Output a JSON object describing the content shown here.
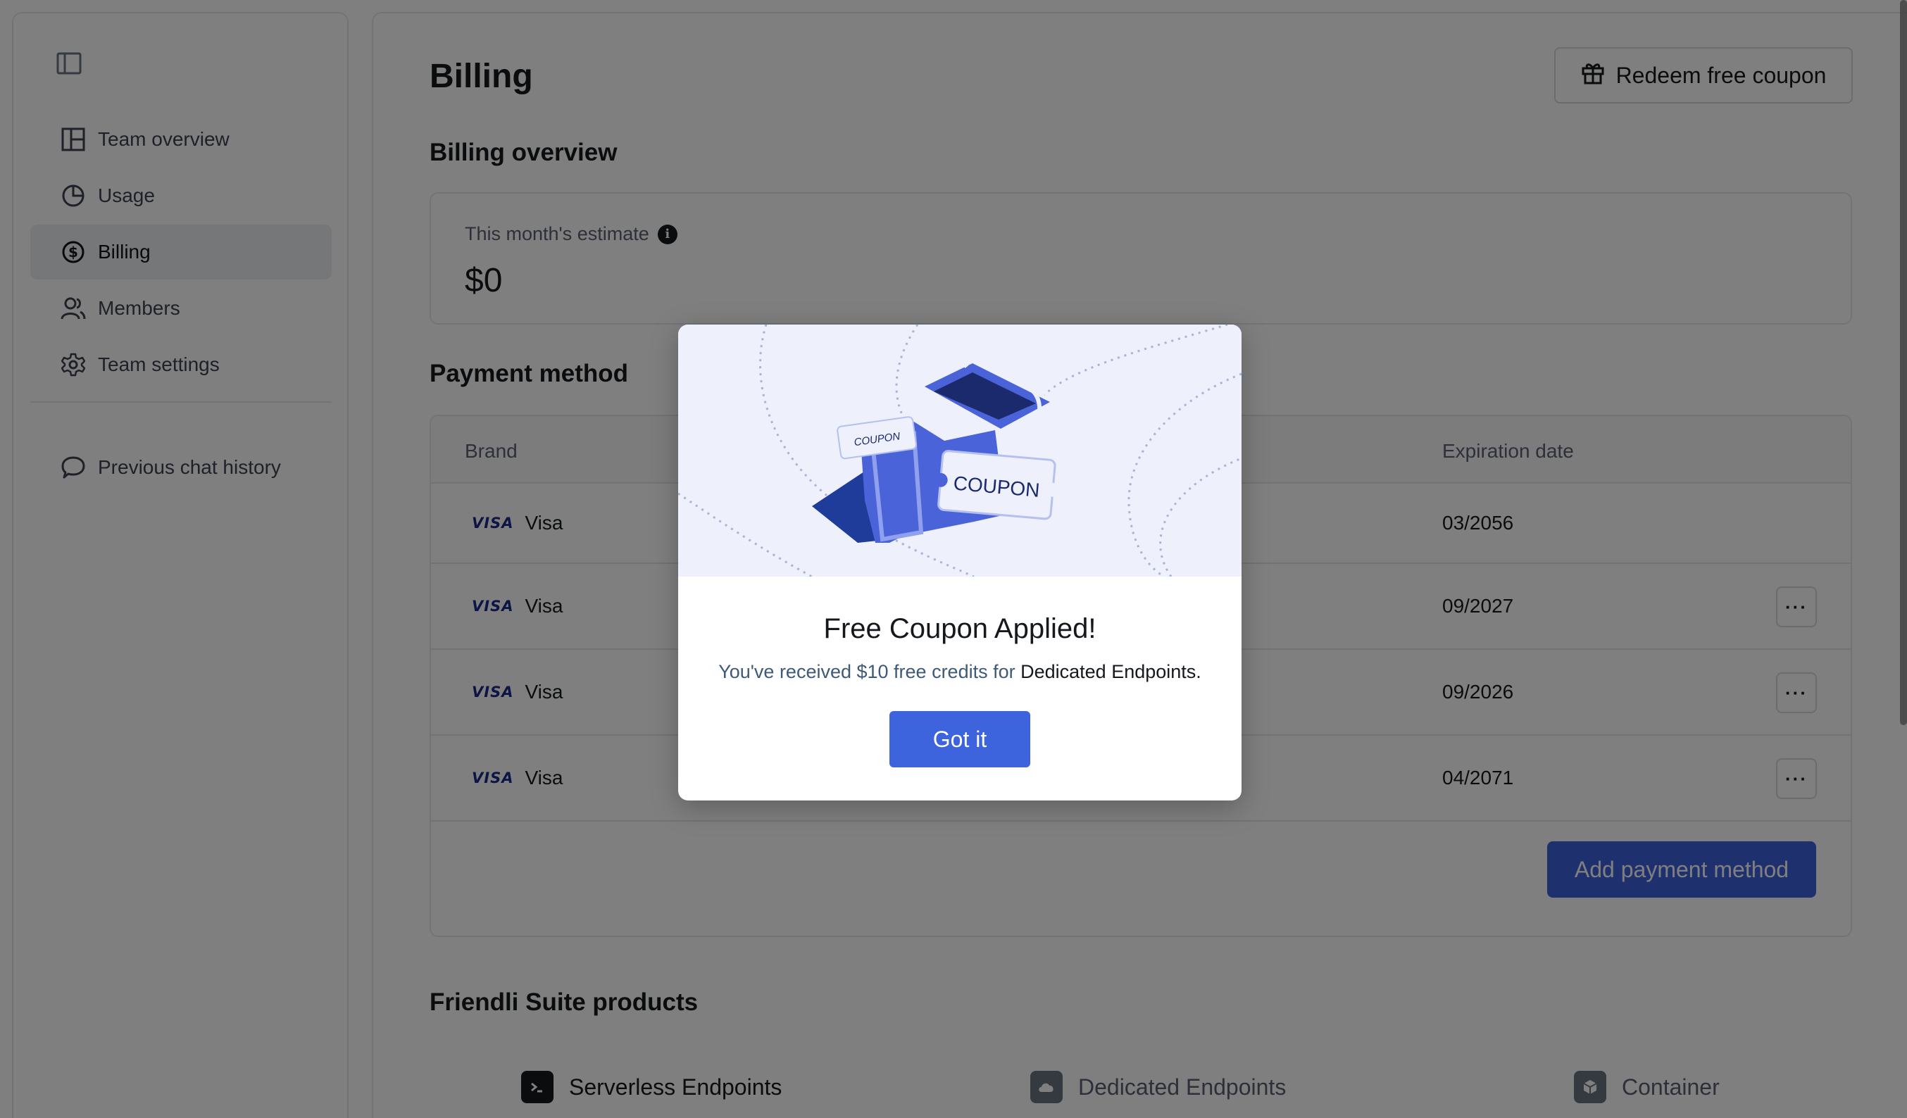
{
  "sidebar": {
    "items": [
      {
        "label": "Team overview",
        "icon": "dashboard-icon"
      },
      {
        "label": "Usage",
        "icon": "pie-chart-icon"
      },
      {
        "label": "Billing",
        "icon": "dollar-circle-icon",
        "active": true
      },
      {
        "label": "Members",
        "icon": "users-icon"
      },
      {
        "label": "Team settings",
        "icon": "gear-icon"
      }
    ],
    "history_label": "Previous chat history"
  },
  "header": {
    "title": "Billing",
    "redeem_label": "Redeem free coupon"
  },
  "overview": {
    "title": "Billing overview",
    "estimate_label": "This month's estimate",
    "estimate_value": "$0"
  },
  "payment": {
    "title": "Payment method",
    "columns": [
      "Brand",
      "Expiration date"
    ],
    "rows": [
      {
        "brand_logo": "VISA",
        "brand": "Visa",
        "expiration": "03/2056"
      },
      {
        "brand_logo": "VISA",
        "brand": "Visa",
        "expiration": "09/2027"
      },
      {
        "brand_logo": "VISA",
        "brand": "Visa",
        "expiration": "09/2026"
      },
      {
        "brand_logo": "VISA",
        "brand": "Visa",
        "expiration": "04/2071"
      }
    ],
    "add_label": "Add payment method"
  },
  "products": {
    "title": "Friendli Suite products",
    "tabs": [
      {
        "label": "Serverless Endpoints",
        "icon": "terminal-icon",
        "active": true
      },
      {
        "label": "Dedicated Endpoints",
        "icon": "cloud-icon"
      },
      {
        "label": "Container",
        "icon": "cube-icon"
      }
    ]
  },
  "modal": {
    "coupon_small": "COUPON",
    "coupon_large": "COUPON",
    "title": "Free Coupon Applied!",
    "text_prefix": "You've received $10 free credits for ",
    "text_emphasis": "Dedicated Endpoints",
    "text_suffix": ".",
    "button_label": "Got it"
  },
  "colors": {
    "accent": "#3d63dd",
    "overlay": "rgba(0,0,0,0.5)",
    "visa_blue": "#1a2a8c"
  }
}
